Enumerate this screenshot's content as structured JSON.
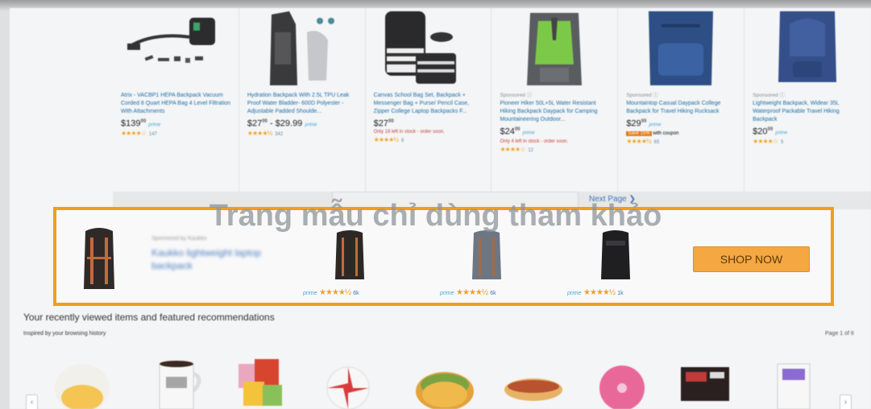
{
  "products": [
    {
      "sponsored": "",
      "title": "Atrix - VACBP1 HEPA Backpack Vacuum Corded 8 Quart HEPA Bag 4 Level Filtration With Attachments",
      "price_main": "$139",
      "price_cents": "99",
      "prime": "prime",
      "stars": "★★★★☆",
      "reviews": "147",
      "stock": ""
    },
    {
      "sponsored": "",
      "title": "Hydration Backpack With 2.5L TPU Leak Proof Water Bladder- 600D Polyester - Adjustable Padded Shoulde...",
      "price_main": "$27",
      "price_cents": "99",
      "price_range": "- $29.99",
      "prime": "prime",
      "stars": "★★★★½",
      "reviews": "342",
      "stock": ""
    },
    {
      "sponsored": "",
      "title": "Canvas School Bag Set, Backpack + Messenger Bag + Purse/ Pencil Case, Zipper College Laptop Backpacks F...",
      "price_main": "$27",
      "price_cents": "99",
      "prime": "",
      "stars": "★★★★½",
      "reviews": "8",
      "stock": "Only 18 left in stock - order soon."
    },
    {
      "sponsored": "Sponsored ⓘ",
      "title": "Pioneer Hiker 50L+5L Water Resistant Hiking Backpack Daypack for Camping Mountaineering Outdoor...",
      "price_main": "$24",
      "price_cents": "99",
      "prime": "prime",
      "stars": "★★★★☆",
      "reviews": "12",
      "stock": "Only 4 left in stock - order soon."
    },
    {
      "sponsored": "Sponsored ⓘ",
      "title": "Mountaintop Casual Daypack College Backpack for Travel Hiking Rucksack",
      "price_main": "$29",
      "price_cents": "99",
      "prime": "prime",
      "save_badge": "Save 15%",
      "save_text": "with coupon",
      "stars": "★★★★½",
      "reviews": "65",
      "stock": ""
    },
    {
      "sponsored": "Sponsored ⓘ",
      "title": "Lightweight Backpack, Widear 35L Waterproof Packable Travel Hiking Backpack",
      "price_main": "$20",
      "price_cents": "99",
      "prime": "prime",
      "stars": "★★★★☆",
      "reviews": "5",
      "stock": ""
    }
  ],
  "pager": {
    "next_label": "Next Page ❯"
  },
  "banner": {
    "label": "Sponsored by Kaukko",
    "title": "Kaukko lightweight laptop backpack",
    "items": [
      {
        "prime": "prime",
        "stars": "★★★★½",
        "count": "6k"
      },
      {
        "prime": "prime",
        "stars": "★★★★½",
        "count": "6k"
      },
      {
        "prime": "prime",
        "stars": "★★★★½",
        "count": "1k"
      }
    ],
    "cta": "SHOP NOW"
  },
  "recent": {
    "heading": "Your recently viewed items and featured recommendations",
    "sub": "Inspired by your browsing history",
    "page": "Page 1 of 6",
    "prev": "‹",
    "next": "›"
  },
  "watermark": "Trang mẫu chỉ dùng tham khảo",
  "colors": {
    "accent_orange": "#f39c1f",
    "link_blue": "#1a6fa8",
    "cta_orange": "#f5a742"
  }
}
